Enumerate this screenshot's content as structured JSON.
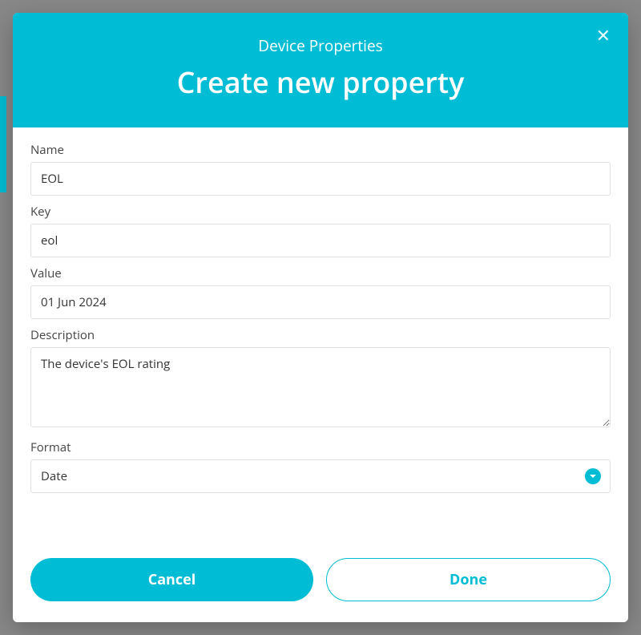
{
  "modal": {
    "subtitle": "Device Properties",
    "title": "Create new property"
  },
  "form": {
    "name": {
      "label": "Name",
      "value": "EOL"
    },
    "key": {
      "label": "Key",
      "value": "eol"
    },
    "value": {
      "label": "Value",
      "value": "01 Jun 2024"
    },
    "description": {
      "label": "Description",
      "value": "The device's EOL rating"
    },
    "format": {
      "label": "Format",
      "value": "Date"
    }
  },
  "buttons": {
    "cancel": "Cancel",
    "done": "Done"
  }
}
